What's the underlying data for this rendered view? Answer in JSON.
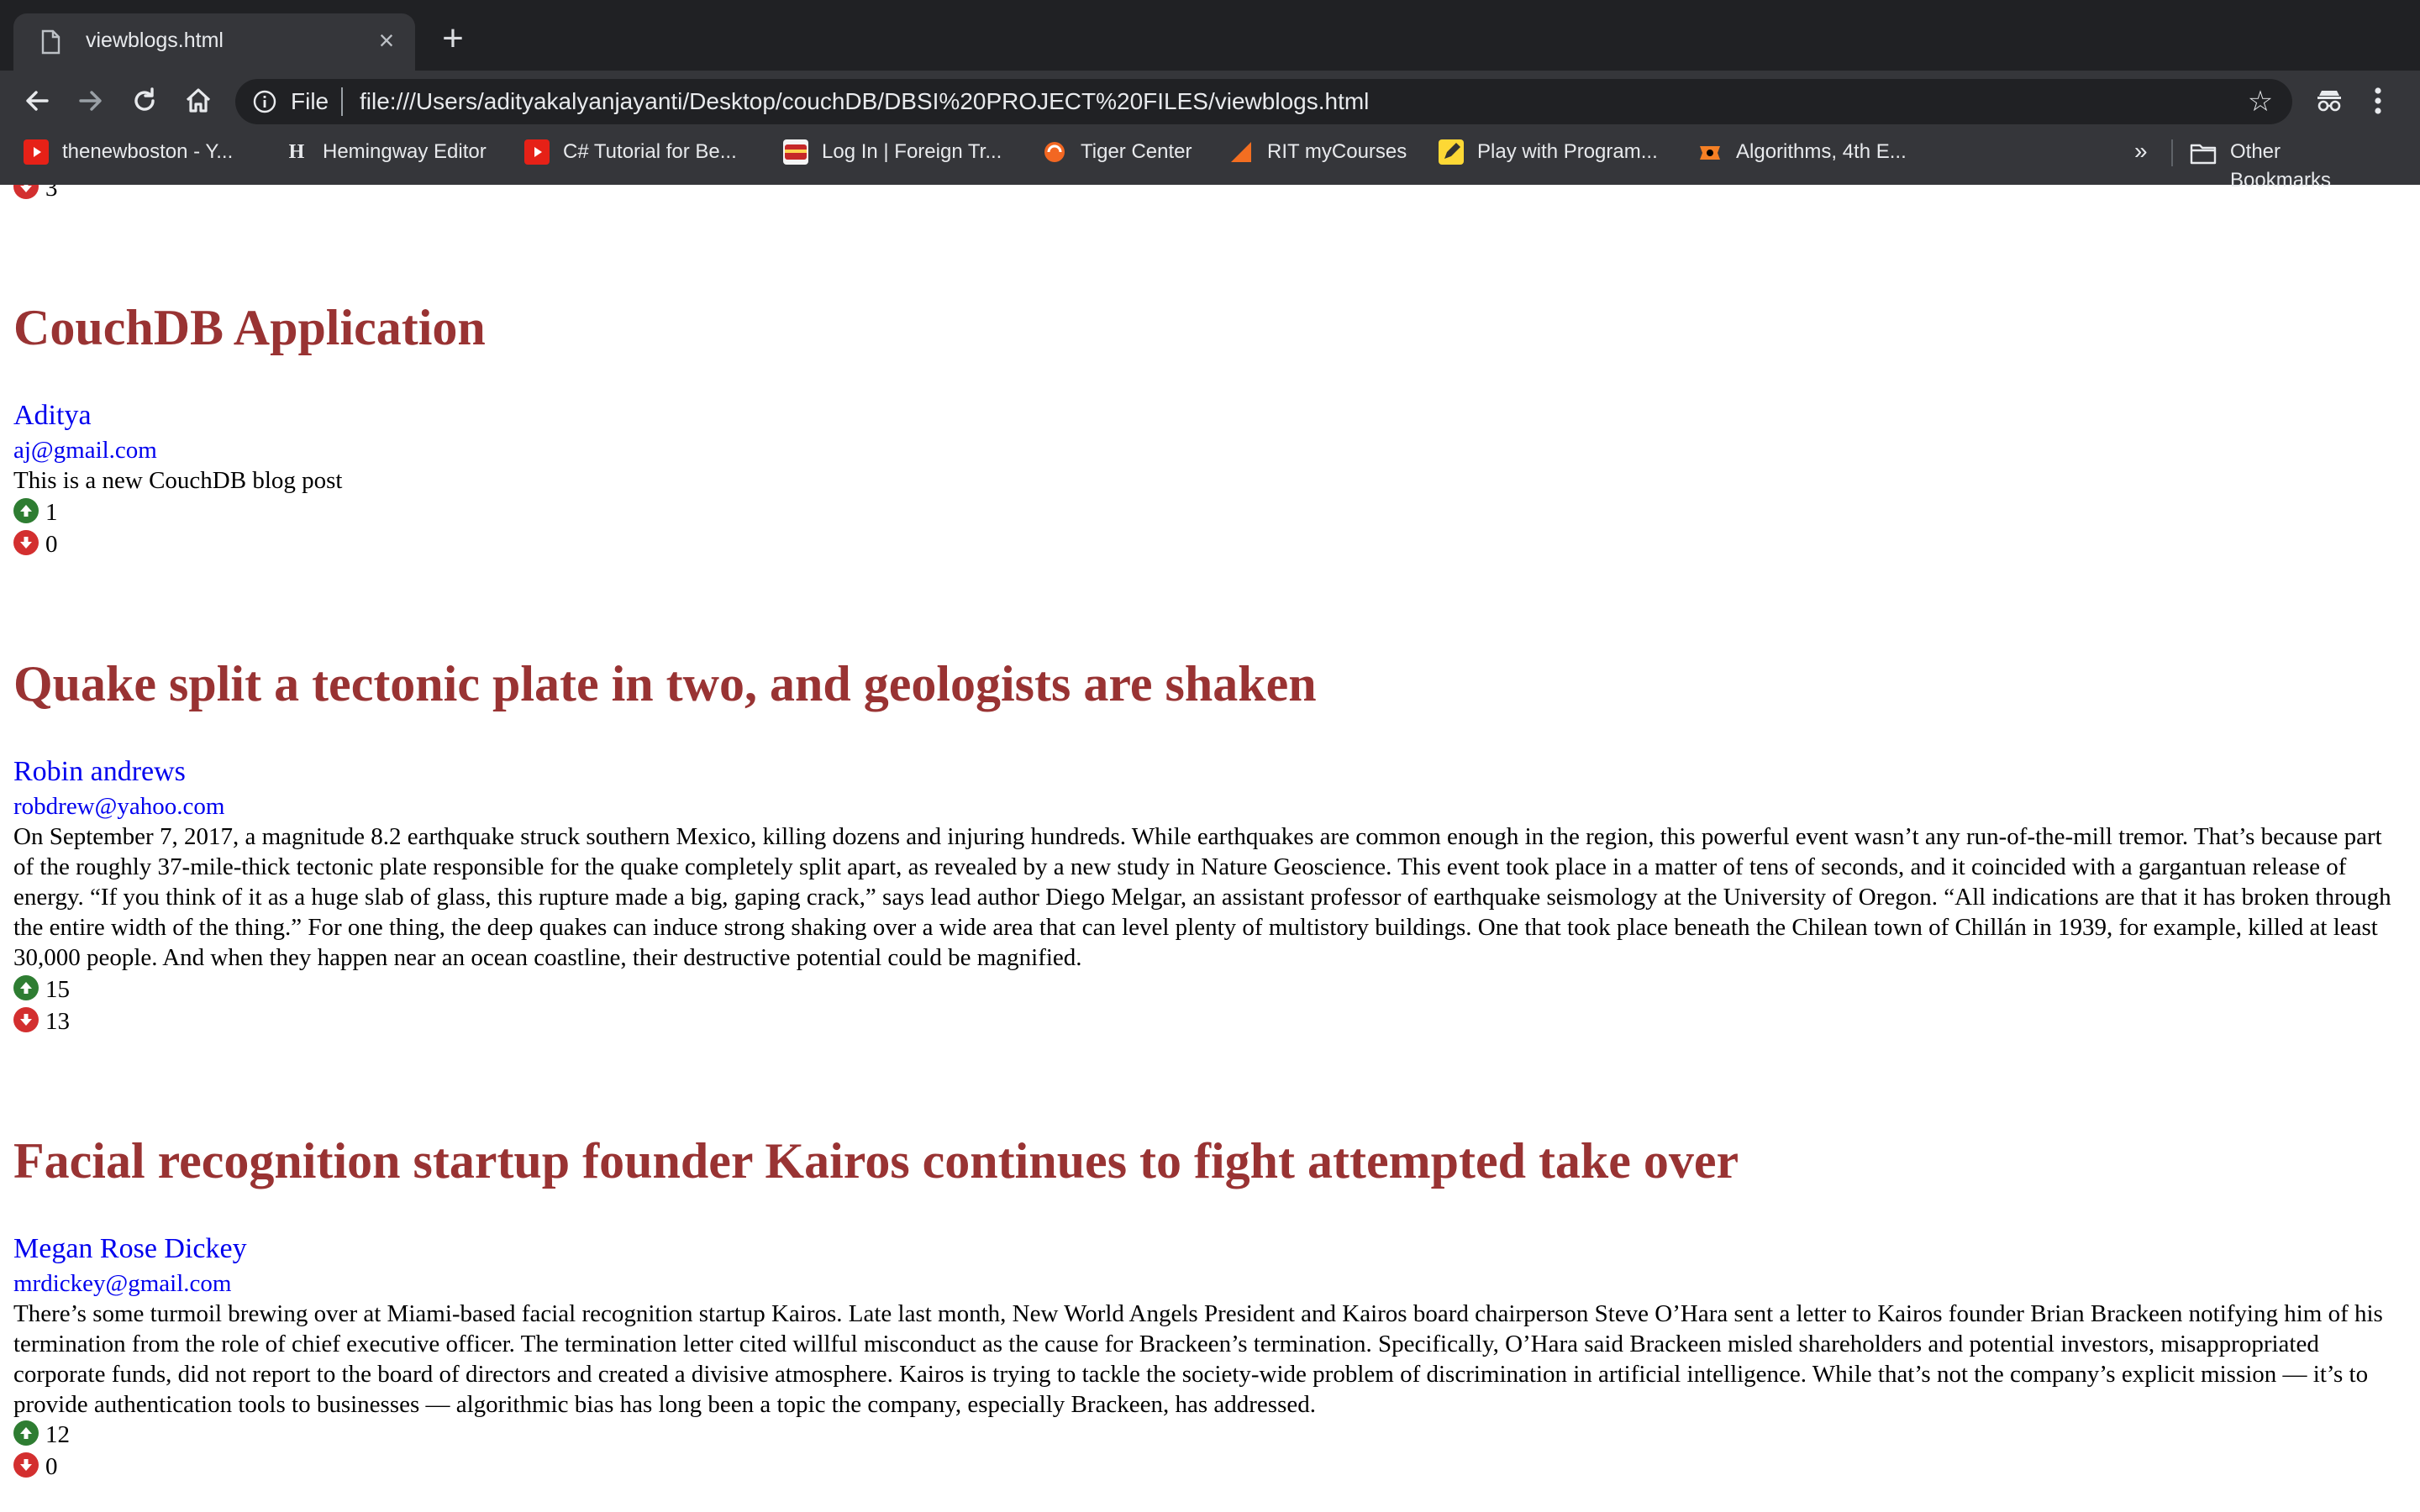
{
  "browser": {
    "tab_title": "viewblogs.html",
    "new_tab_label": "+",
    "scheme_label": "File",
    "url": "file:///Users/adityakalyanjayanti/Desktop/couchDB/DBSI%20PROJECT%20FILES/viewblogs.html",
    "bookmarks": [
      {
        "label": "thenewboston - Y...",
        "icon": "youtube-icon"
      },
      {
        "label": "Hemingway Editor",
        "icon": "hemingway-icon"
      },
      {
        "label": "C# Tutorial for Be...",
        "icon": "youtube-icon"
      },
      {
        "label": "Log In | Foreign Tr...",
        "icon": "card-icon"
      },
      {
        "label": "Tiger Center",
        "icon": "tiger-icon"
      },
      {
        "label": "RIT myCourses",
        "icon": "mycourses-icon"
      },
      {
        "label": "Play with Program...",
        "icon": "pencil-icon"
      },
      {
        "label": "Algorithms, 4th E...",
        "icon": "princeton-icon"
      }
    ],
    "bookmarks_overflow": "»",
    "other_bookmarks": "Other Bookmarks"
  },
  "partial_top_count": "3",
  "posts": [
    {
      "title": "CouchDB Application",
      "author": "Aditya",
      "email": "aj@gmail.com",
      "body": "This is a new CouchDB blog post",
      "upvotes": "1",
      "downvotes": "0"
    },
    {
      "title": "Quake split a tectonic plate in two, and geologists are shaken",
      "author": "Robin andrews",
      "email": "robdrew@yahoo.com",
      "body": "On September 7, 2017, a magnitude 8.2 earthquake struck southern Mexico, killing dozens and injuring hundreds. While earthquakes are common enough in the region, this powerful event wasn’t any run-of-the-mill tremor. That’s because part of the roughly 37-mile-thick tectonic plate responsible for the quake completely split apart, as revealed by a new study in Nature Geoscience. This event took place in a matter of tens of seconds, and it coincided with a gargantuan release of energy. “If you think of it as a huge slab of glass, this rupture made a big, gaping crack,” says lead author Diego Melgar, an assistant professor of earthquake seismology at the University of Oregon. “All indications are that it has broken through the entire width of the thing.” For one thing, the deep quakes can induce strong shaking over a wide area that can level plenty of multistory buildings. One that took place beneath the Chilean town of Chillán in 1939, for example, killed at least 30,000 people. And when they happen near an ocean coastline, their destructive potential could be magnified.",
      "upvotes": "15",
      "downvotes": "13"
    },
    {
      "title": "Facial recognition startup founder Kairos continues to fight attempted take over",
      "author": "Megan Rose Dickey",
      "email": "mrdickey@gmail.com",
      "body": "There’s some turmoil brewing over at Miami-based facial recognition startup Kairos. Late last month, New World Angels President and Kairos board chairperson Steve O’Hara sent a letter to Kairos founder Brian Brackeen notifying him of his termination from the role of chief executive officer. The termination letter cited willful misconduct as the cause for Brackeen’s termination. Specifically, O’Hara said Brackeen misled shareholders and potential investors, misappropriated corporate funds, did not report to the board of directors and created a divisive atmosphere. Kairos is trying to tackle the society-wide problem of discrimination in artificial intelligence. While that’s not the company’s explicit mission — it’s to provide authentication tools to businesses — algorithmic bias has long been a topic the company, especially Brackeen, has addressed.",
      "upvotes": "12",
      "downvotes": "0"
    }
  ]
}
